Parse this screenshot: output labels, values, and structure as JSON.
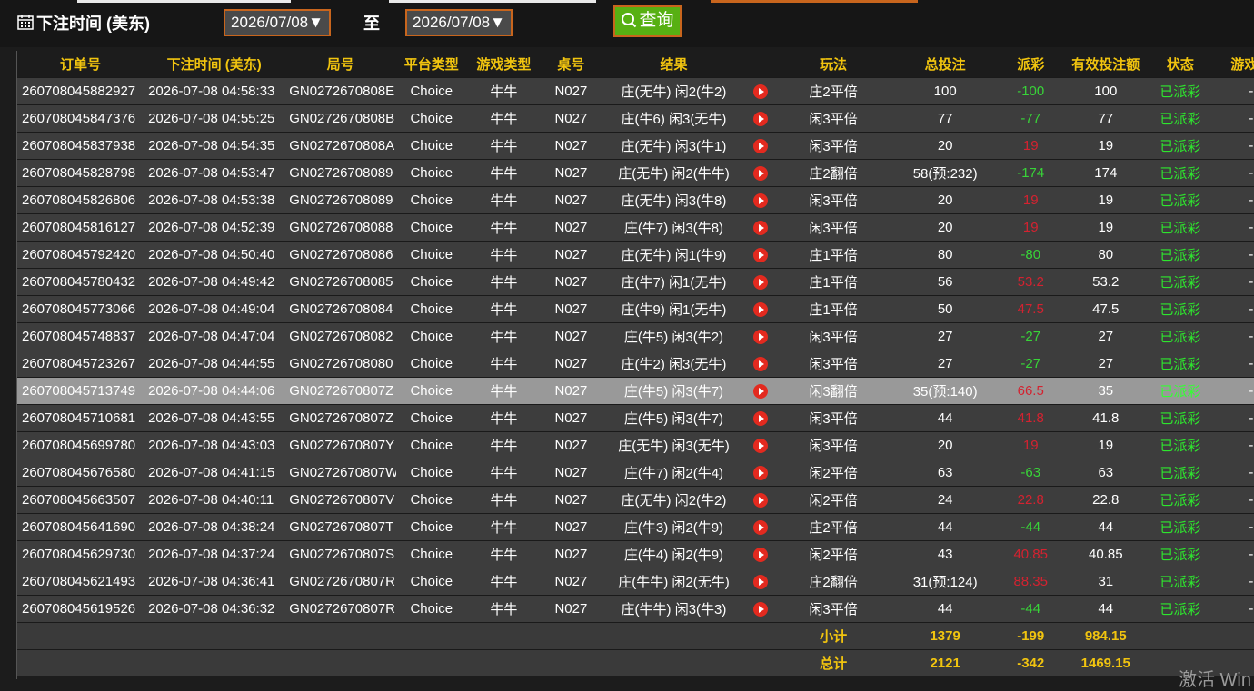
{
  "filter": {
    "label": "下注时间 (美东)",
    "start_date": "2026/07/08▼",
    "to_label": "至",
    "end_date": "2026/07/08▼",
    "query_label": "查询"
  },
  "table": {
    "headers": [
      "订单号",
      "下注时间 (美东)",
      "局号",
      "平台类型",
      "游戏类型",
      "桌号",
      "结果",
      "",
      "玩法",
      "总投注",
      "派彩",
      "有效投注额",
      "状态",
      "游戏机"
    ],
    "rows": [
      [
        "260708045882927",
        "2026-07-08 04:58:33",
        "GN0272670808E",
        "Choice",
        "牛牛",
        "N027",
        "庄(无牛) 闲2(牛2)",
        "庄2平倍",
        "100",
        "-100",
        "100",
        "已派彩",
        "-"
      ],
      [
        "260708045847376",
        "2026-07-08 04:55:25",
        "GN0272670808B",
        "Choice",
        "牛牛",
        "N027",
        "庄(牛6) 闲3(无牛)",
        "闲3平倍",
        "77",
        "-77",
        "77",
        "已派彩",
        "-"
      ],
      [
        "260708045837938",
        "2026-07-08 04:54:35",
        "GN0272670808A",
        "Choice",
        "牛牛",
        "N027",
        "庄(无牛) 闲3(牛1)",
        "闲3平倍",
        "20",
        "19",
        "19",
        "已派彩",
        "-"
      ],
      [
        "260708045828798",
        "2026-07-08 04:53:47",
        "GN02726708089",
        "Choice",
        "牛牛",
        "N027",
        "庄(无牛) 闲2(牛牛)",
        "庄2翻倍",
        "58(预:232)",
        "-174",
        "174",
        "已派彩",
        "-"
      ],
      [
        "260708045826806",
        "2026-07-08 04:53:38",
        "GN02726708089",
        "Choice",
        "牛牛",
        "N027",
        "庄(无牛) 闲3(牛8)",
        "闲3平倍",
        "20",
        "19",
        "19",
        "已派彩",
        "-"
      ],
      [
        "260708045816127",
        "2026-07-08 04:52:39",
        "GN02726708088",
        "Choice",
        "牛牛",
        "N027",
        "庄(牛7) 闲3(牛8)",
        "闲3平倍",
        "20",
        "19",
        "19",
        "已派彩",
        "-"
      ],
      [
        "260708045792420",
        "2026-07-08 04:50:40",
        "GN02726708086",
        "Choice",
        "牛牛",
        "N027",
        "庄(无牛) 闲1(牛9)",
        "庄1平倍",
        "80",
        "-80",
        "80",
        "已派彩",
        "-"
      ],
      [
        "260708045780432",
        "2026-07-08 04:49:42",
        "GN02726708085",
        "Choice",
        "牛牛",
        "N027",
        "庄(牛7) 闲1(无牛)",
        "庄1平倍",
        "56",
        "53.2",
        "53.2",
        "已派彩",
        "-"
      ],
      [
        "260708045773066",
        "2026-07-08 04:49:04",
        "GN02726708084",
        "Choice",
        "牛牛",
        "N027",
        "庄(牛9) 闲1(无牛)",
        "庄1平倍",
        "50",
        "47.5",
        "47.5",
        "已派彩",
        "-"
      ],
      [
        "260708045748837",
        "2026-07-08 04:47:04",
        "GN02726708082",
        "Choice",
        "牛牛",
        "N027",
        "庄(牛5) 闲3(牛2)",
        "闲3平倍",
        "27",
        "-27",
        "27",
        "已派彩",
        "-"
      ],
      [
        "260708045723267",
        "2026-07-08 04:44:55",
        "GN02726708080",
        "Choice",
        "牛牛",
        "N027",
        "庄(牛2) 闲3(无牛)",
        "闲3平倍",
        "27",
        "-27",
        "27",
        "已派彩",
        "-"
      ],
      [
        "260708045713749",
        "2026-07-08 04:44:06",
        "GN0272670807Z",
        "Choice",
        "牛牛",
        "N027",
        "庄(牛5) 闲3(牛7)",
        "闲3翻倍",
        "35(预:140)",
        "66.5",
        "35",
        "已派彩",
        "-"
      ],
      [
        "260708045710681",
        "2026-07-08 04:43:55",
        "GN0272670807Z",
        "Choice",
        "牛牛",
        "N027",
        "庄(牛5) 闲3(牛7)",
        "闲3平倍",
        "44",
        "41.8",
        "41.8",
        "已派彩",
        "-"
      ],
      [
        "260708045699780",
        "2026-07-08 04:43:03",
        "GN0272670807Y",
        "Choice",
        "牛牛",
        "N027",
        "庄(无牛) 闲3(无牛)",
        "闲3平倍",
        "20",
        "19",
        "19",
        "已派彩",
        "-"
      ],
      [
        "260708045676580",
        "2026-07-08 04:41:15",
        "GN0272670807W",
        "Choice",
        "牛牛",
        "N027",
        "庄(牛7) 闲2(牛4)",
        "闲2平倍",
        "63",
        "-63",
        "63",
        "已派彩",
        "-"
      ],
      [
        "260708045663507",
        "2026-07-08 04:40:11",
        "GN0272670807V",
        "Choice",
        "牛牛",
        "N027",
        "庄(无牛) 闲2(牛2)",
        "闲2平倍",
        "24",
        "22.8",
        "22.8",
        "已派彩",
        "-"
      ],
      [
        "260708045641690",
        "2026-07-08 04:38:24",
        "GN0272670807T",
        "Choice",
        "牛牛",
        "N027",
        "庄(牛3) 闲2(牛9)",
        "庄2平倍",
        "44",
        "-44",
        "44",
        "已派彩",
        "-"
      ],
      [
        "260708045629730",
        "2026-07-08 04:37:24",
        "GN0272670807S",
        "Choice",
        "牛牛",
        "N027",
        "庄(牛4) 闲2(牛9)",
        "闲2平倍",
        "43",
        "40.85",
        "40.85",
        "已派彩",
        "-"
      ],
      [
        "260708045621493",
        "2026-07-08 04:36:41",
        "GN0272670807R",
        "Choice",
        "牛牛",
        "N027",
        "庄(牛牛) 闲2(无牛)",
        "庄2翻倍",
        "31(预:124)",
        "88.35",
        "31",
        "已派彩",
        "-"
      ],
      [
        "260708045619526",
        "2026-07-08 04:36:32",
        "GN0272670807R",
        "Choice",
        "牛牛",
        "N027",
        "庄(牛牛) 闲3(牛3)",
        "闲3平倍",
        "44",
        "-44",
        "44",
        "已派彩",
        "-"
      ]
    ],
    "subtotal": {
      "label": "小计",
      "total_bet": "1379",
      "payout": "-199",
      "valid_bet": "984.15"
    },
    "total": {
      "label": "总计",
      "total_bet": "2121",
      "payout": "-342",
      "valid_bet": "1469.15"
    },
    "highlight_row_index": 11
  },
  "watermark": "激活 Win",
  "colors": {
    "header_text": "#f1c40f",
    "negative": "#38d438",
    "positive": "#d42230",
    "status": "#2ee62e",
    "accent_border": "#c8651d",
    "query_bg": "#57b013",
    "play_icon": "#e32a1f"
  }
}
